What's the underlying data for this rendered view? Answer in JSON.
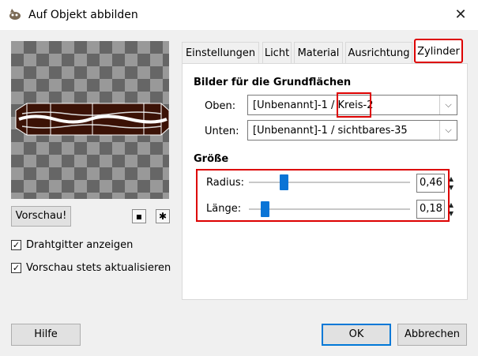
{
  "window": {
    "title": "Auf Objekt abbilden",
    "close_glyph": "✕",
    "app_icon": "gimp-icon"
  },
  "left": {
    "preview_button": "Vorschau!",
    "zoom_out_glyph": "▪",
    "zoom_in_glyph": "✱",
    "wireframe_label": "Drahtgitter anzeigen",
    "wireframe_checked": true,
    "auto_update_label": "Vorschau stets aktualisieren",
    "auto_update_checked": true,
    "check_glyph": "✓"
  },
  "tabs": [
    "Einstellungen",
    "Licht",
    "Material",
    "Ausrichtung",
    "Zylinder"
  ],
  "active_tab": "Zylinder",
  "cylinder": {
    "base_images_heading": "Bilder für die Grundflächen",
    "top_label": "Oben:",
    "top_value": "[Unbenannt]-1 / Kreis-2",
    "bottom_label": "Unten:",
    "bottom_value": "[Unbenannt]-1 / sichtbares-35",
    "combo_arrow_glyph": "⌵",
    "size_heading": "Größe",
    "radius_label": "Radius:",
    "radius_value": "0,46",
    "radius_fraction": 0.2,
    "length_label": "Länge:",
    "length_value": "0,18",
    "length_fraction": 0.08,
    "spin_glyph": "▲\n▼"
  },
  "buttons": {
    "help": "Hilfe",
    "ok": "OK",
    "cancel": "Abbrechen"
  },
  "colors": {
    "highlight_red": "#dd0000",
    "slider_blue": "#0a74d6",
    "cylinder_brown": "#3b1206"
  }
}
